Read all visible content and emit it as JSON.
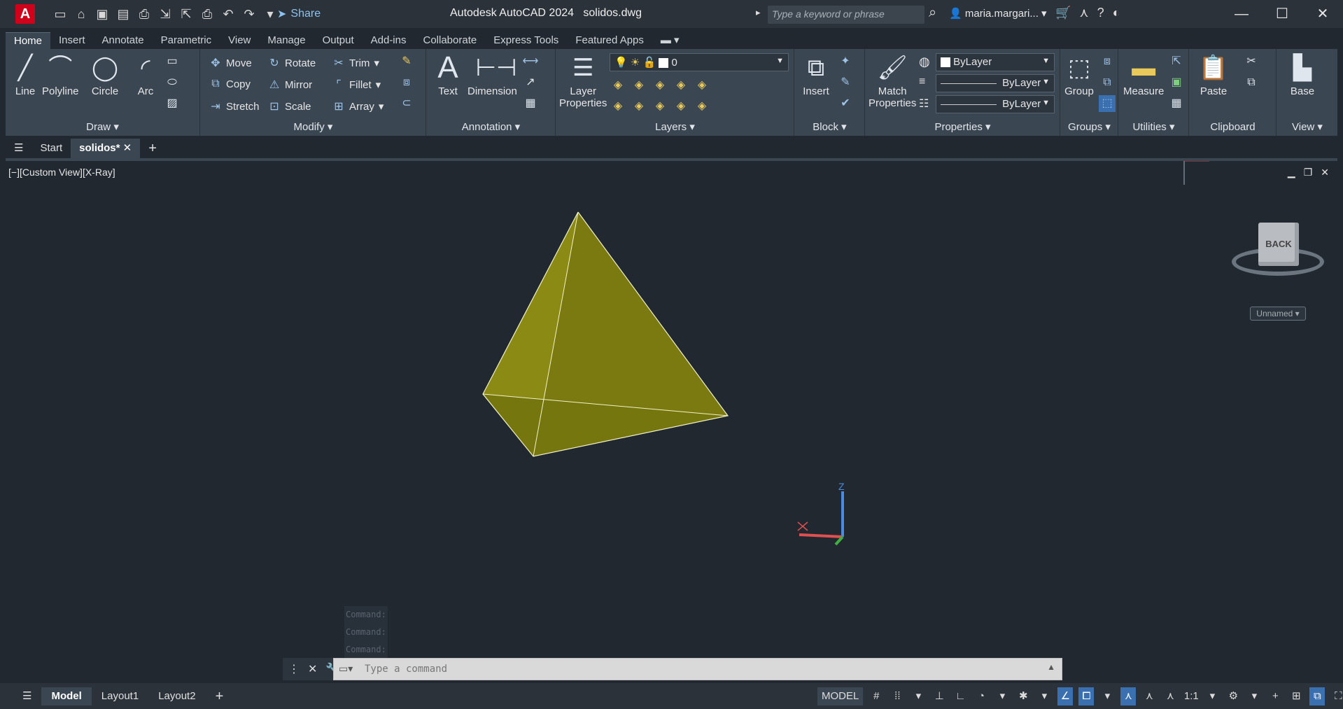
{
  "titlebar": {
    "app_title": "Autodesk AutoCAD 2024",
    "file_name": "solidos.dwg",
    "share_label": "Share",
    "search_placeholder": "Type a keyword or phrase",
    "user_name": "maria.margari..."
  },
  "ribbon_tabs": [
    "Home",
    "Insert",
    "Annotate",
    "Parametric",
    "View",
    "Manage",
    "Output",
    "Add-ins",
    "Collaborate",
    "Express Tools",
    "Featured Apps"
  ],
  "ribbon": {
    "draw": {
      "title": "Draw",
      "line": "Line",
      "polyline": "Polyline",
      "circle": "Circle",
      "arc": "Arc"
    },
    "modify": {
      "title": "Modify",
      "move": "Move",
      "rotate": "Rotate",
      "trim": "Trim",
      "copy": "Copy",
      "mirror": "Mirror",
      "fillet": "Fillet",
      "stretch": "Stretch",
      "scale": "Scale",
      "array": "Array"
    },
    "annotation": {
      "title": "Annotation",
      "text": "Text",
      "dimension": "Dimension"
    },
    "layers": {
      "title": "Layers",
      "layer_properties_1": "Layer",
      "layer_properties_2": "Properties",
      "current_layer": "0"
    },
    "block": {
      "title": "Block",
      "insert": "Insert"
    },
    "properties": {
      "title": "Properties",
      "match_1": "Match",
      "match_2": "Properties",
      "color": "ByLayer",
      "linetype": "ByLayer",
      "lineweight": "ByLayer"
    },
    "groups": {
      "title": "Groups",
      "group": "Group"
    },
    "utilities": {
      "title": "Utilities",
      "measure": "Measure"
    },
    "clipboard": {
      "title": "Clipboard",
      "paste": "Paste"
    },
    "view": {
      "title": "View",
      "base": "Base"
    }
  },
  "filetabs": {
    "start": "Start",
    "current": "solidos*"
  },
  "viewport": {
    "label": "[−][Custom View][X-Ray]",
    "viewcube_face": "BACK",
    "named_view": "Unnamed",
    "history": [
      "Command:",
      "Command:",
      "Command:"
    ],
    "ucs_z": "Z"
  },
  "cmdline": {
    "placeholder": "Type a command"
  },
  "statusbar": {
    "layout_tabs": [
      "Model",
      "Layout1",
      "Layout2"
    ],
    "model_label": "MODEL",
    "scale": "1:1"
  },
  "colors": {
    "solid_fill": "#7d7d12",
    "background": "#212830",
    "ribbon": "#3b4653"
  }
}
